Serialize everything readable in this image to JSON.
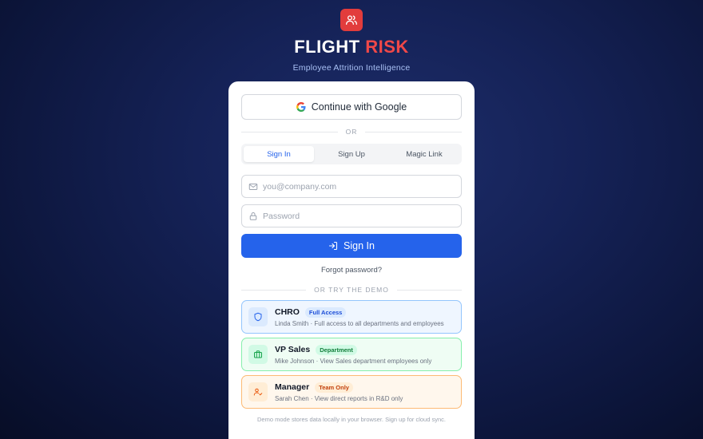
{
  "brand": {
    "title_main": "FLIGHT",
    "title_accent": "RISK",
    "subtitle": "Employee Attrition Intelligence"
  },
  "auth": {
    "google_label": "Continue with Google",
    "or_label": "OR",
    "tabs": [
      {
        "label": "Sign In",
        "active": true
      },
      {
        "label": "Sign Up",
        "active": false
      },
      {
        "label": "Magic Link",
        "active": false
      }
    ],
    "email_placeholder": "you@company.com",
    "password_placeholder": "Password",
    "signin_label": "Sign In",
    "forgot_label": "Forgot password?"
  },
  "demo": {
    "divider_label": "OR TRY THE DEMO",
    "roles": [
      {
        "name": "CHRO",
        "badge": "Full Access",
        "desc": "Linda Smith · Full access to all departments and employees",
        "icon": "shield-icon",
        "accent": "#2563eb"
      },
      {
        "name": "VP Sales",
        "badge": "Department",
        "desc": "Mike Johnson · View Sales department employees only",
        "icon": "briefcase-icon",
        "accent": "#16a34a"
      },
      {
        "name": "Manager",
        "badge": "Team Only",
        "desc": "Sarah Chen · View direct reports in R&D only",
        "icon": "user-check-icon",
        "accent": "#ea580c"
      }
    ],
    "footnote": "Demo mode stores data locally in your browser. Sign up for cloud sync."
  },
  "colors": {
    "brand_red": "#e23c3c",
    "primary_blue": "#2563eb",
    "chro_bg": "#eff6ff",
    "chro_border": "#93c5fd",
    "chro_badge_bg": "#dbeafe",
    "vp_bg": "#effdf4",
    "vp_border": "#86efac",
    "vp_badge_bg": "#d1fae5",
    "mgr_bg": "#fff7ed",
    "mgr_border": "#fdba74",
    "mgr_badge_bg": "#ffedd5"
  }
}
